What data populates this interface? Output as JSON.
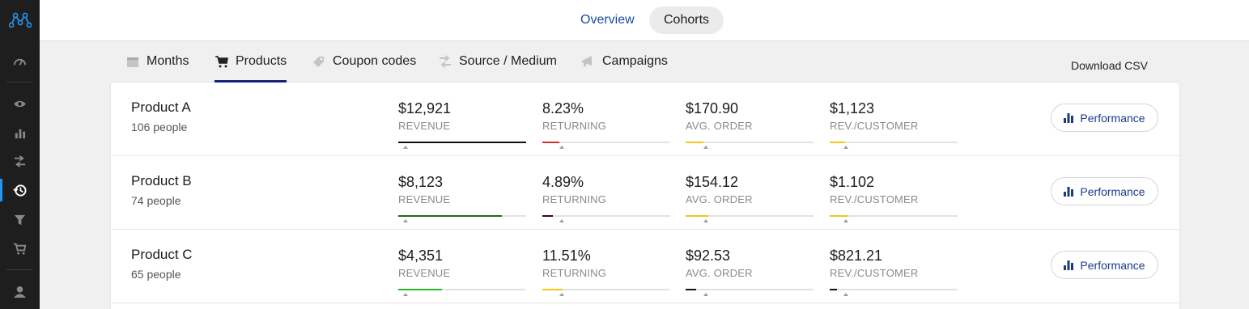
{
  "top_tabs": {
    "overview": "Overview",
    "cohorts": "Cohorts"
  },
  "sub_tabs": [
    {
      "label": "Months",
      "icon": "calendar-icon"
    },
    {
      "label": "Products",
      "icon": "cart-icon",
      "active": true
    },
    {
      "label": "Coupon codes",
      "icon": "tag-icon"
    },
    {
      "label": "Source / Medium",
      "icon": "shuffle-icon"
    },
    {
      "label": "Campaigns",
      "icon": "megaphone-icon"
    }
  ],
  "download_label": "Download CSV",
  "performance_label": "Performance",
  "metric_labels": [
    "REVENUE",
    "RETURNING",
    "AVG. ORDER",
    "REV./CUSTOMER"
  ],
  "products": [
    {
      "name": "Product A",
      "people": "106 people",
      "metrics": [
        {
          "value": "$12,921",
          "bar_fraction": 1.0,
          "color": "#111111"
        },
        {
          "value": "8.23%",
          "bar_fraction": 0.13,
          "color": "#d32f2f"
        },
        {
          "value": "$170.90",
          "bar_fraction": 0.14,
          "color": "#f5c518"
        },
        {
          "value": "$1,123",
          "bar_fraction": 0.12,
          "color": "#f5c518"
        }
      ]
    },
    {
      "name": "Product B",
      "people": "74 people",
      "metrics": [
        {
          "value": "$8,123",
          "bar_fraction": 0.81,
          "color": "#1b6e1b"
        },
        {
          "value": "4.89%",
          "bar_fraction": 0.08,
          "color": "#3a0a0a"
        },
        {
          "value": "$154.12",
          "bar_fraction": 0.18,
          "color": "#f5c518"
        },
        {
          "value": "$1.102",
          "bar_fraction": 0.14,
          "color": "#f5c518"
        }
      ]
    },
    {
      "name": "Product C",
      "people": "65 people",
      "metrics": [
        {
          "value": "$4,351",
          "bar_fraction": 0.34,
          "color": "#2bb52b"
        },
        {
          "value": "11.51%",
          "bar_fraction": 0.16,
          "color": "#f5c518"
        },
        {
          "value": "$92.53",
          "bar_fraction": 0.08,
          "color": "#111111"
        },
        {
          "value": "$821.21",
          "bar_fraction": 0.06,
          "color": "#111111"
        }
      ]
    }
  ],
  "sidebar_icons": [
    "speedometer-icon",
    "eye-icon",
    "bar-chart-icon",
    "shuffle-icon",
    "history-icon",
    "funnel-icon",
    "cart-icon",
    "user-icon"
  ]
}
